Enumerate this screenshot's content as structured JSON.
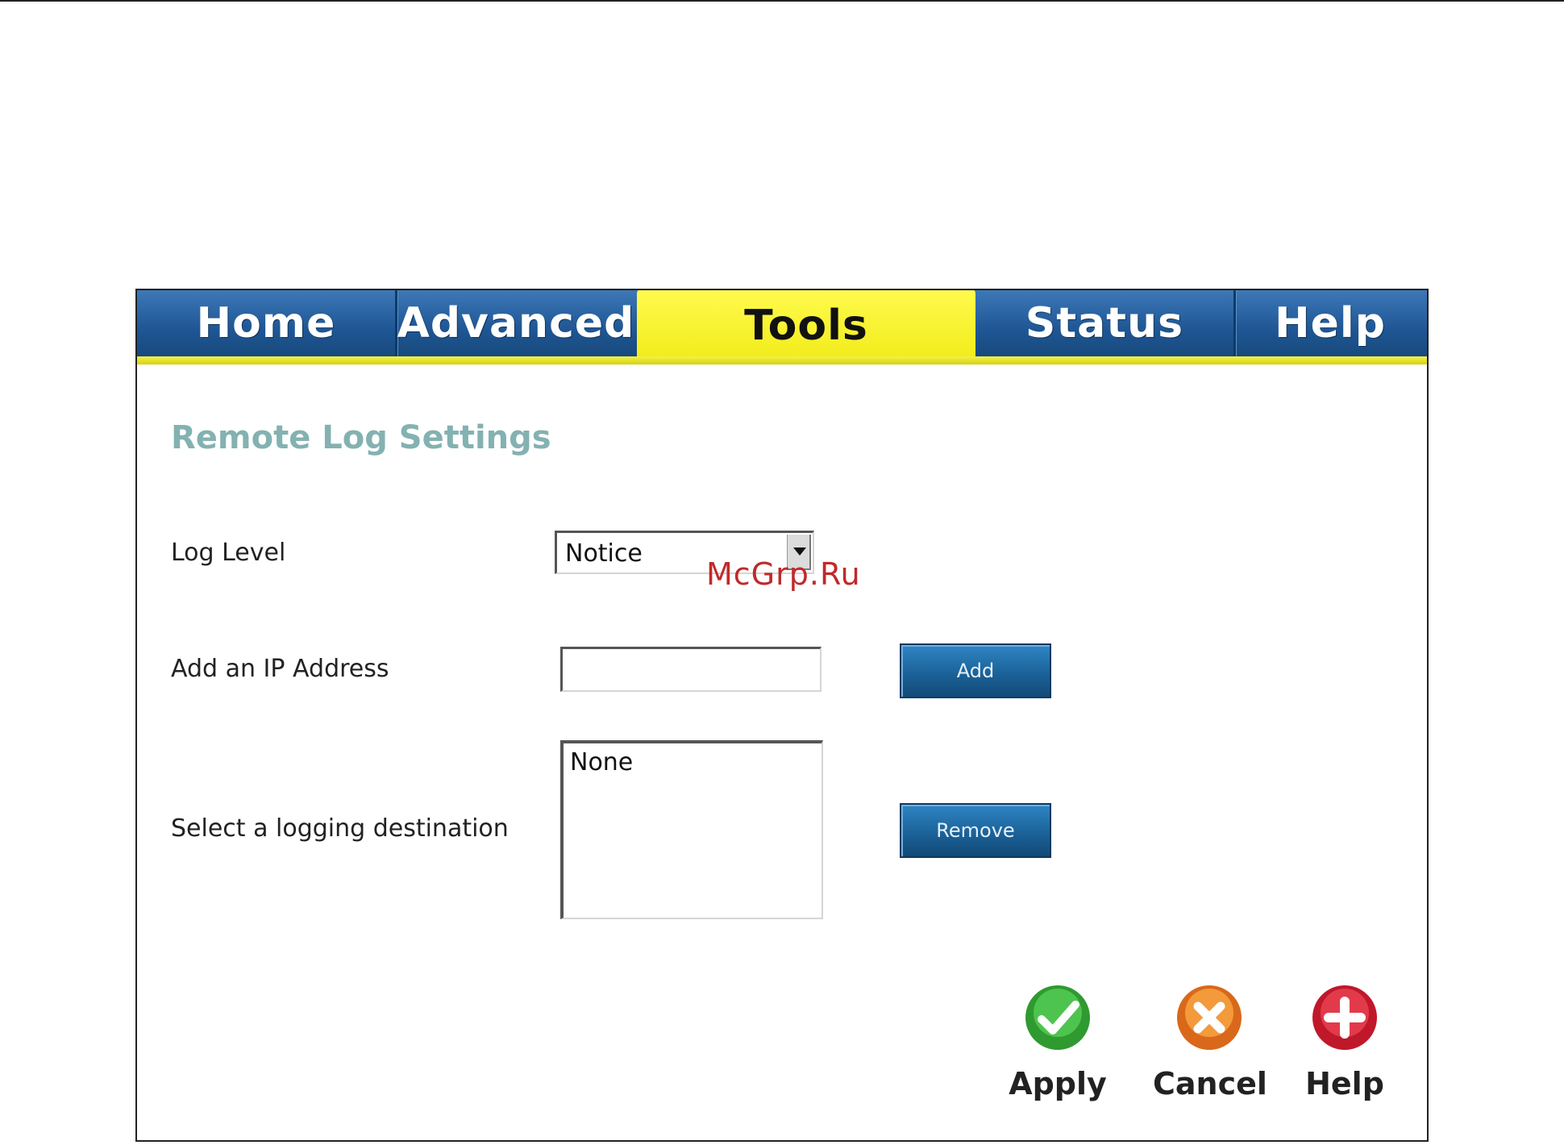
{
  "nav": {
    "tabs": [
      {
        "label": "Home"
      },
      {
        "label": "Advanced"
      },
      {
        "label": "Tools"
      },
      {
        "label": "Status"
      },
      {
        "label": "Help"
      }
    ],
    "active": "Tools"
  },
  "page": {
    "title": "Remote Log Settings"
  },
  "form": {
    "log_level": {
      "label": "Log Level",
      "selected": "Notice"
    },
    "add_ip": {
      "label": "Add an IP Address",
      "value": "",
      "button": "Add"
    },
    "destination": {
      "label": "Select a logging destination",
      "options": [
        "None"
      ],
      "button": "Remove"
    }
  },
  "actions": {
    "apply": "Apply",
    "cancel": "Cancel",
    "help": "Help"
  },
  "watermark": "McGrp.Ru",
  "colors": {
    "nav_blue": "#1e5593",
    "nav_active_yellow": "#f1eb18",
    "title_teal": "#84b1b1",
    "button_blue": "#1a5f95"
  }
}
